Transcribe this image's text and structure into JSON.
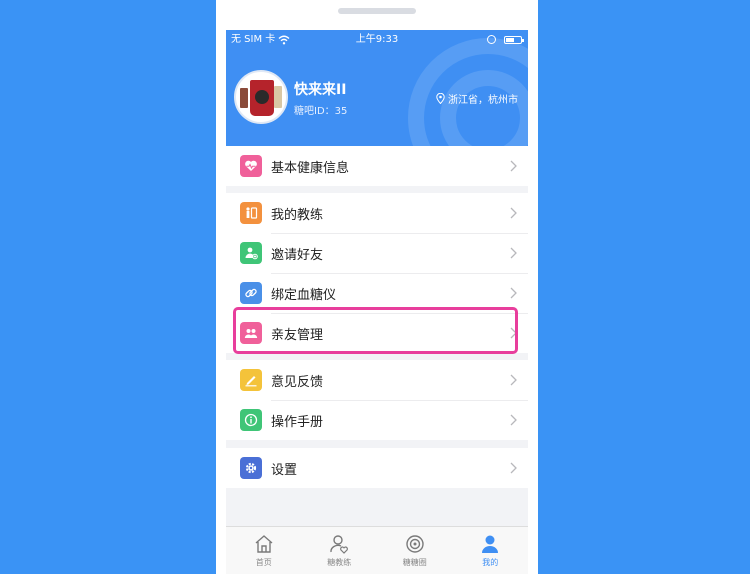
{
  "status_bar": {
    "carrier": "无 SIM 卡",
    "time": "上午9:33"
  },
  "profile": {
    "username": "快来来II",
    "user_id": "糖吧ID：35",
    "location": "浙江省，杭州市"
  },
  "menu": {
    "group1": [
      {
        "label": "基本健康信息",
        "icon": "heart-monitor-icon",
        "color": "#f0609a"
      }
    ],
    "group2": [
      {
        "label": "我的教练",
        "icon": "coach-icon",
        "color": "#f3913e"
      },
      {
        "label": "邀请好友",
        "icon": "invite-friend-icon",
        "color": "#3fc577"
      },
      {
        "label": "绑定血糖仪",
        "icon": "link-icon",
        "color": "#4a90e8"
      },
      {
        "label": "亲友管理",
        "icon": "family-icon",
        "color": "#f0609a"
      }
    ],
    "group3": [
      {
        "label": "意见反馈",
        "icon": "feedback-pen-icon",
        "color": "#f4c33a"
      },
      {
        "label": "操作手册",
        "icon": "manual-info-icon",
        "color": "#3fc577"
      }
    ],
    "group4": [
      {
        "label": "设置",
        "icon": "settings-gear-icon",
        "color": "#4a6fd6"
      }
    ]
  },
  "highlight_color": "#e83e9c",
  "tabbar": [
    {
      "label": "首页",
      "icon": "home-icon",
      "active": false
    },
    {
      "label": "糖教练",
      "icon": "coach-heart-icon",
      "active": false
    },
    {
      "label": "糖糖圈",
      "icon": "circle-target-icon",
      "active": false
    },
    {
      "label": "我的",
      "icon": "user-icon",
      "active": true
    }
  ]
}
